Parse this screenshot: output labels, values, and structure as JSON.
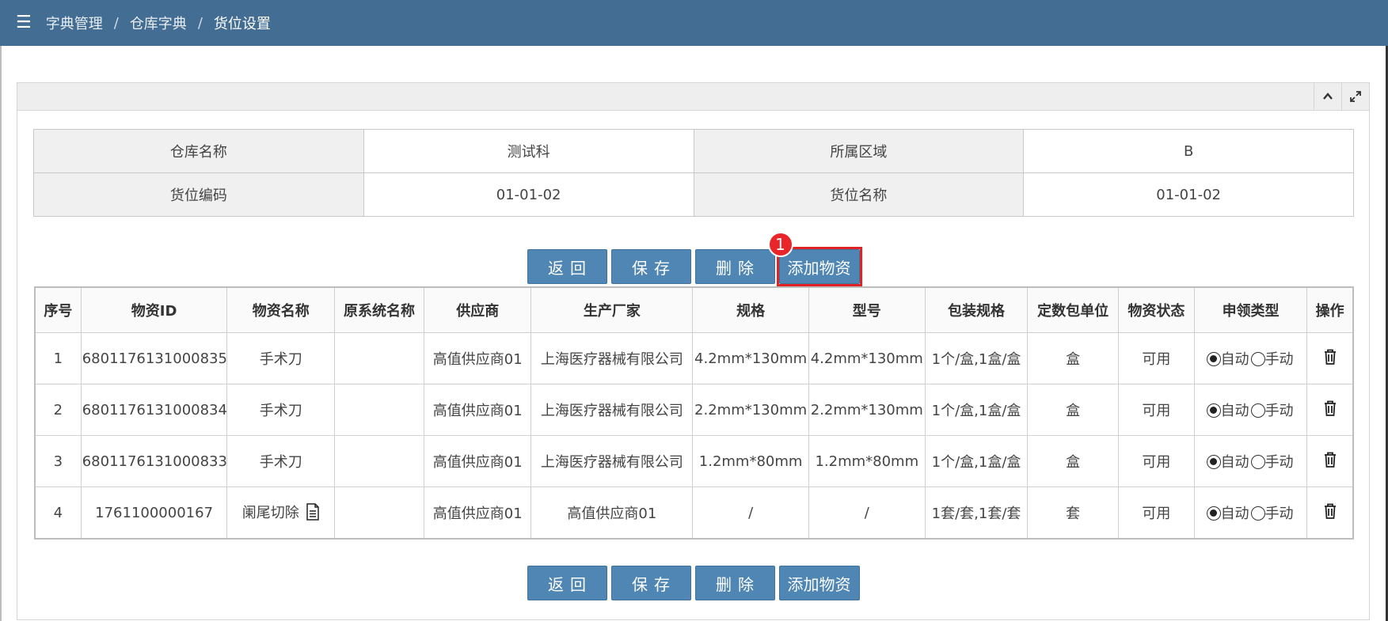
{
  "breadcrumb": [
    "字典管理",
    "仓库字典",
    "货位设置"
  ],
  "info": {
    "warehouse_name_label": "仓库名称",
    "warehouse_name_value": "测试科",
    "area_label": "所属区域",
    "area_value": "B",
    "location_code_label": "货位编码",
    "location_code_value": "01-01-02",
    "location_name_label": "货位名称",
    "location_name_value": "01-01-02"
  },
  "buttons": {
    "back": "返回",
    "save": "保存",
    "delete": "删除",
    "add": "添加物资"
  },
  "annotation_badge": "1",
  "table": {
    "headers": [
      "序号",
      "物资ID",
      "物资名称",
      "原系统名称",
      "供应商",
      "生产厂家",
      "规格",
      "型号",
      "包装规格",
      "定数包单位",
      "物资状态",
      "申领类型",
      "操作"
    ],
    "radio_auto": "自动",
    "radio_manual": "手动",
    "rows": [
      {
        "no": "1",
        "id": "6801176131000835",
        "name": "手术刀",
        "orig": "",
        "supplier": "高值供应商01",
        "maker": "上海医疗器械有限公司",
        "spec": "4.2mm*130mm",
        "model": "4.2mm*130mm",
        "pack": "1个/盒,1盒/盒",
        "unit": "盒",
        "status": "可用"
      },
      {
        "no": "2",
        "id": "6801176131000834",
        "name": "手术刀",
        "orig": "",
        "supplier": "高值供应商01",
        "maker": "上海医疗器械有限公司",
        "spec": "2.2mm*130mm",
        "model": "2.2mm*130mm",
        "pack": "1个/盒,1盒/盒",
        "unit": "盒",
        "status": "可用"
      },
      {
        "no": "3",
        "id": "6801176131000833",
        "name": "手术刀",
        "orig": "",
        "supplier": "高值供应商01",
        "maker": "上海医疗器械有限公司",
        "spec": "1.2mm*80mm",
        "model": "1.2mm*80mm",
        "pack": "1个/盒,1盒/盒",
        "unit": "盒",
        "status": "可用"
      },
      {
        "no": "4",
        "id": "1761100000167",
        "name": "阑尾切除",
        "orig": "",
        "supplier": "高值供应商01",
        "maker": "高值供应商01",
        "spec": "/",
        "model": "/",
        "pack": "1套/套,1套/套",
        "unit": "套",
        "status": "可用"
      }
    ]
  }
}
